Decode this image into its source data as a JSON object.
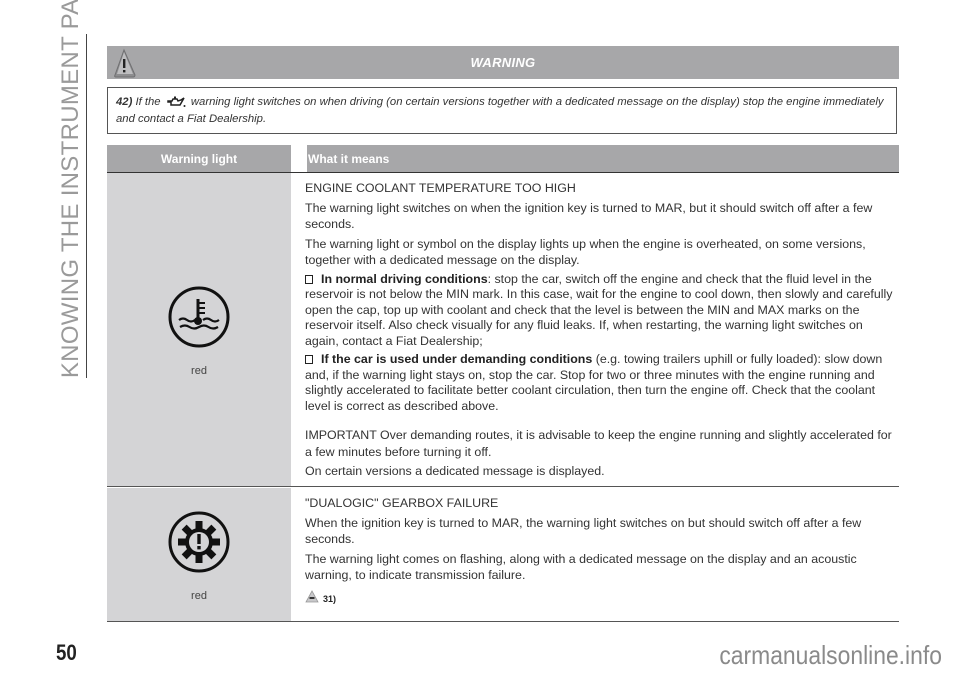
{
  "side_title": "KNOWING THE INSTRUMENT PANEL",
  "page_number": "50",
  "watermark": "carmanualsonline.info",
  "warning": {
    "icon": "warning-triangle-icon",
    "title": "WARNING",
    "number": "42)",
    "text_before_icon": "If the",
    "inline_icon": "oil-pressure-icon",
    "text_after_icon": "warning light switches on when driving (on certain versions together with a dedicated message on the display) stop the engine immediately and contact a Fiat Dealership."
  },
  "table": {
    "headers": [
      "Warning light",
      "What it means"
    ],
    "rows": [
      {
        "icon": "coolant-temperature-icon",
        "color": "red",
        "title": "ENGINE COOLANT TEMPERATURE TOO HIGH",
        "paragraphs": [
          "The warning light switches on when the ignition key is turned to MAR, but it should switch off after a few seconds.",
          "The warning light or symbol on the display lights up when the engine is overheated, on some versions, together with a dedicated message on the display."
        ],
        "bullets": [
          {
            "bold": "In normal driving conditions",
            "text": ": stop the car, switch off the engine and check that the fluid level in the reservoir is not below the MIN mark. In this case, wait for the engine to cool down, then slowly and carefully open the cap, top up with coolant and check that the level is between the MIN and MAX marks on the reservoir itself. Also check visually for any fluid leaks. If, when restarting, the warning light switches on again, contact a Fiat Dealership;"
          },
          {
            "bold": "If the car is used under demanding conditions",
            "text": " (e.g. towing trailers uphill or fully loaded): slow down and, if the warning light stays on, stop the car. Stop for two or three minutes with the engine running and slightly accelerated to facilitate better coolant circulation, then turn the engine off. Check that the coolant level is correct as described above."
          }
        ],
        "notes": [
          "IMPORTANT Over demanding routes, it is advisable to keep the engine running and slightly accelerated for a few minutes before turning it off.",
          "On certain versions a dedicated message is displayed."
        ]
      },
      {
        "icon": "gearbox-failure-icon",
        "color": "red",
        "title": "\"DUALOGIC\" GEARBOX FAILURE",
        "paragraphs": [
          "When the ignition key is turned to MAR, the warning light switches on but should switch off after a few seconds.",
          "The warning light comes on flashing, along with a dedicated message on the display and an acoustic warning, to indicate transmission failure."
        ],
        "reference": "31)"
      }
    ]
  }
}
